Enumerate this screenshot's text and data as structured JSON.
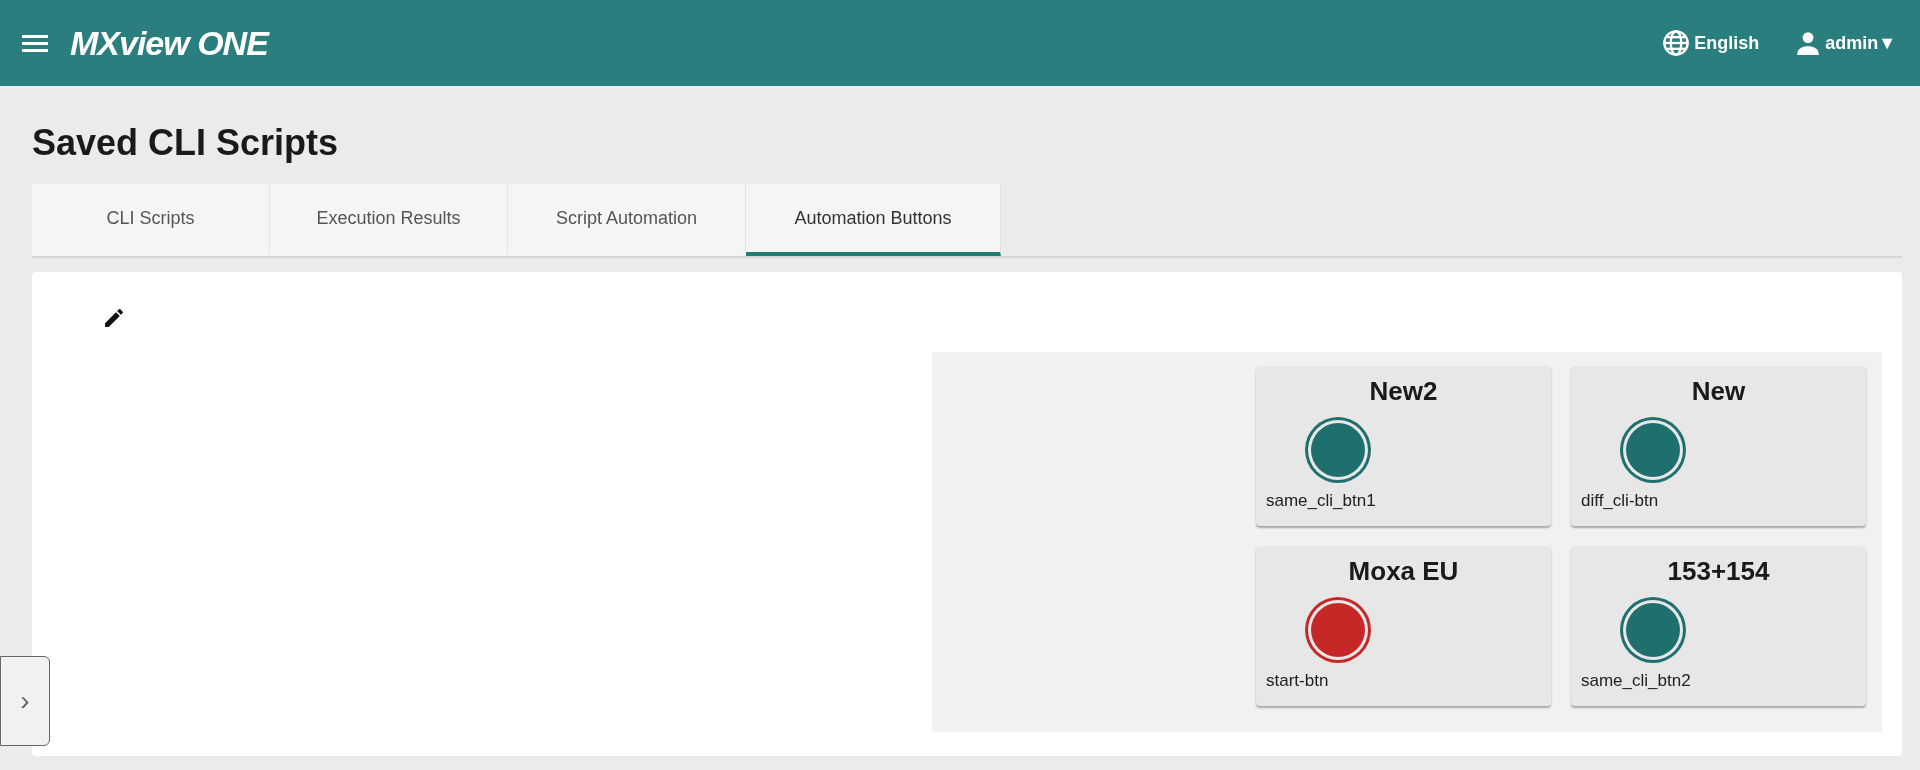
{
  "header": {
    "logo": "MXview ONE",
    "language": "English",
    "user": "admin▼"
  },
  "page_title": "Saved CLI Scripts",
  "tabs": [
    {
      "label": "CLI Scripts",
      "selected": false
    },
    {
      "label": "Execution Results",
      "selected": false
    },
    {
      "label": "Script Automation",
      "selected": false
    },
    {
      "label": "Automation Buttons",
      "selected": true
    }
  ],
  "buttons": [
    {
      "title": "New2",
      "label": "same_cli_btn1",
      "color": "#1f6f6e"
    },
    {
      "title": "New",
      "label": "diff_cli-btn",
      "color": "#1f6f6e"
    },
    {
      "title": "Moxa EU",
      "label": "start-btn",
      "color": "#c62828"
    },
    {
      "title": "153+154",
      "label": "same_cli_btn2",
      "color": "#1f6f6e"
    }
  ],
  "side_toggle": "›"
}
